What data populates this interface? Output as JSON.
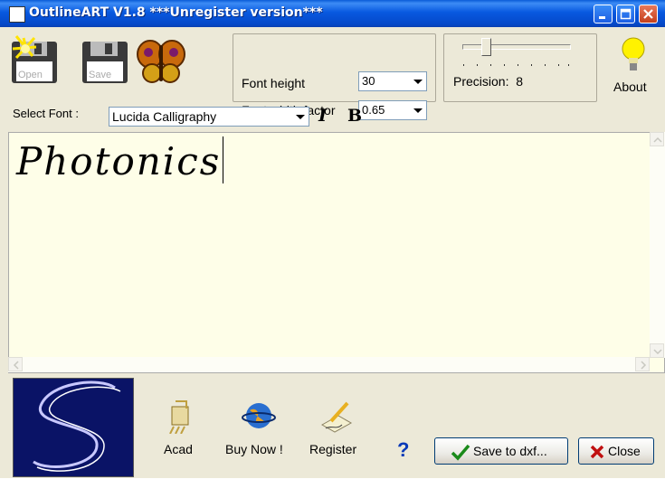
{
  "window": {
    "title": "OutlineART V1.8 ***Unregister version***",
    "icon_text": "T E",
    "controls": [
      "minimize-icon",
      "maximize-icon",
      "close-icon"
    ]
  },
  "toolbar": {
    "open_label": "Open",
    "save_label": "Save",
    "font_height_label": "Font height",
    "font_height_value": "30",
    "font_width_label": "Font width factor",
    "font_width_value": "0.65",
    "precision_label": "Precision:",
    "precision_value": "8",
    "about_label": "About"
  },
  "font_row": {
    "label": "Select Font :",
    "font_value": "Lucida Calligraphy",
    "italic_label": "I",
    "bold_label": "B"
  },
  "editor": {
    "text": "Photonics",
    "background": "#fefee8"
  },
  "bottom": {
    "acad_label": "Acad",
    "buy_label": "Buy Now !",
    "register_label": "Register",
    "help_label": "?",
    "save_dxf_label": "Save to dxf...",
    "close_label": "Close"
  },
  "colors": {
    "titlebar": "#0a5bd8",
    "logo_bg": "#0a1366",
    "window_bg": "#ece9d8"
  }
}
